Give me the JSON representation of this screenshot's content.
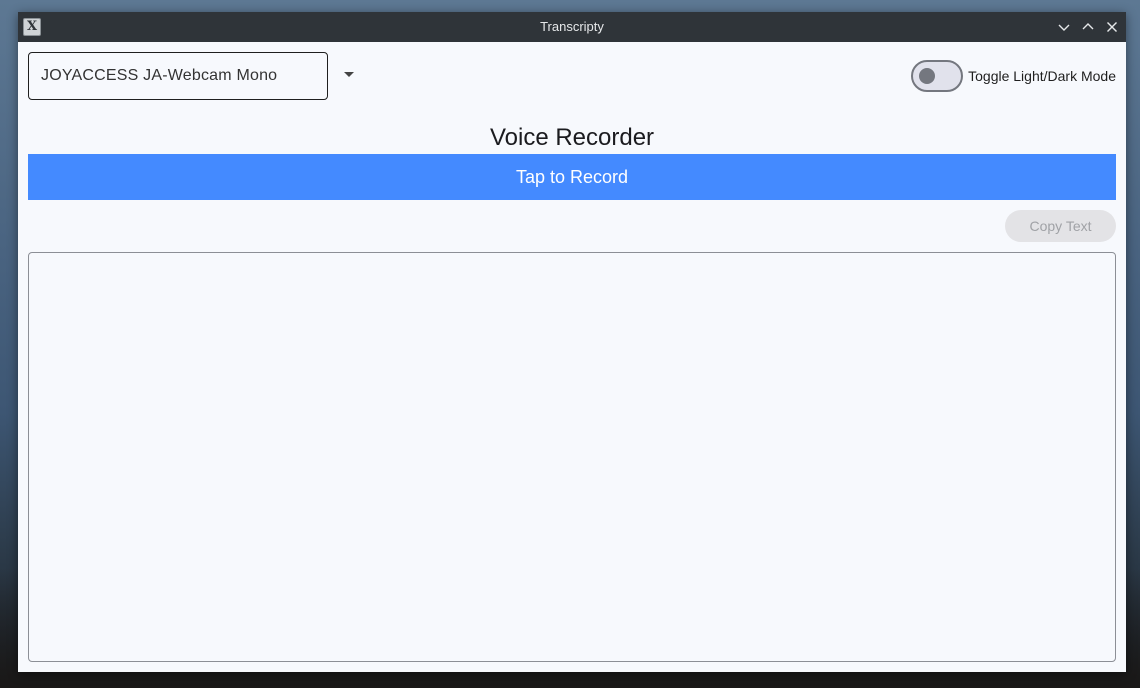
{
  "window": {
    "title": "Transcripty",
    "app_icon_glyph": "X"
  },
  "device": {
    "selected": "JOYACCESS JA-Webcam Mono"
  },
  "toggle": {
    "label": "Toggle Light/Dark Mode"
  },
  "heading": "Voice Recorder",
  "record_button": "Tap to Record",
  "copy_button": "Copy Text",
  "transcript": {
    "text": ""
  },
  "colors": {
    "accent": "#448aff",
    "titlebar": "#2f3439",
    "background": "#f7f9fd"
  },
  "icons": {
    "minimize": "chevron-down-icon",
    "maximize": "chevron-up-icon",
    "close": "close-icon"
  }
}
